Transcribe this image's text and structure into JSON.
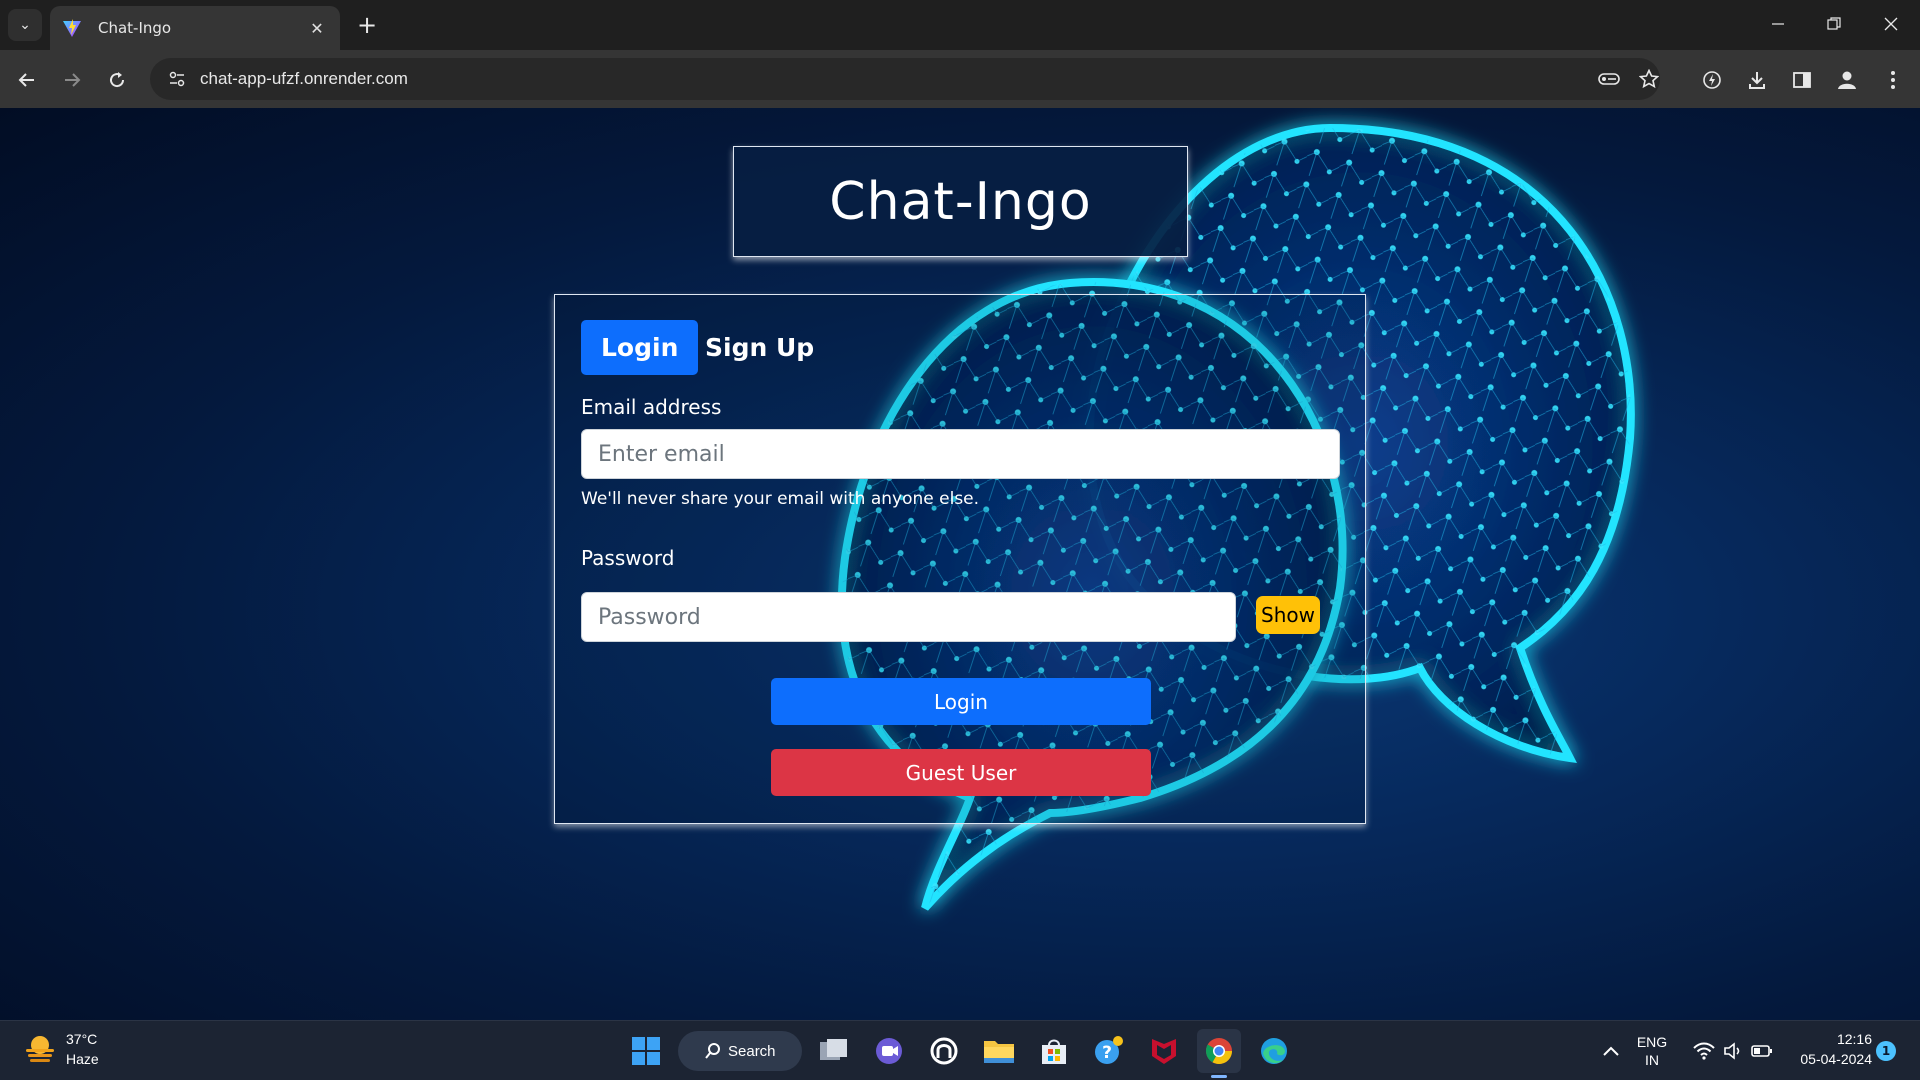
{
  "browser": {
    "tab_title": "Chat-Ingo",
    "url": "chat-app-ufzf.onrender.com"
  },
  "page": {
    "brand_title": "Chat-Ingo",
    "tabs": [
      {
        "label": "Login",
        "active": true
      },
      {
        "label": "Sign Up",
        "active": false
      }
    ],
    "email": {
      "label": "Email address",
      "placeholder": "Enter email",
      "help_text": "We'll never share your email with anyone else."
    },
    "password": {
      "label": "Password",
      "placeholder": "Password",
      "show_label": "Show"
    },
    "login_button": "Login",
    "guest_button": "Guest User",
    "colors": {
      "primary": "#0d6efd",
      "danger": "#dc3545",
      "warning": "#ffc107",
      "glow": "#22d3ff"
    }
  },
  "taskbar": {
    "weather_temp": "37°C",
    "weather_desc": "Haze",
    "search_label": "Search",
    "lang_line1": "ENG",
    "lang_line2": "IN",
    "time": "12:16",
    "date": "05-04-2024",
    "notification_count": "1",
    "apps": [
      "windows-start-icon",
      "task-view-icon",
      "meet-icon",
      "app-icon",
      "file-explorer-icon",
      "microsoft-store-icon",
      "help-icon",
      "mcafee-icon",
      "chrome-icon",
      "edge-icon"
    ]
  }
}
